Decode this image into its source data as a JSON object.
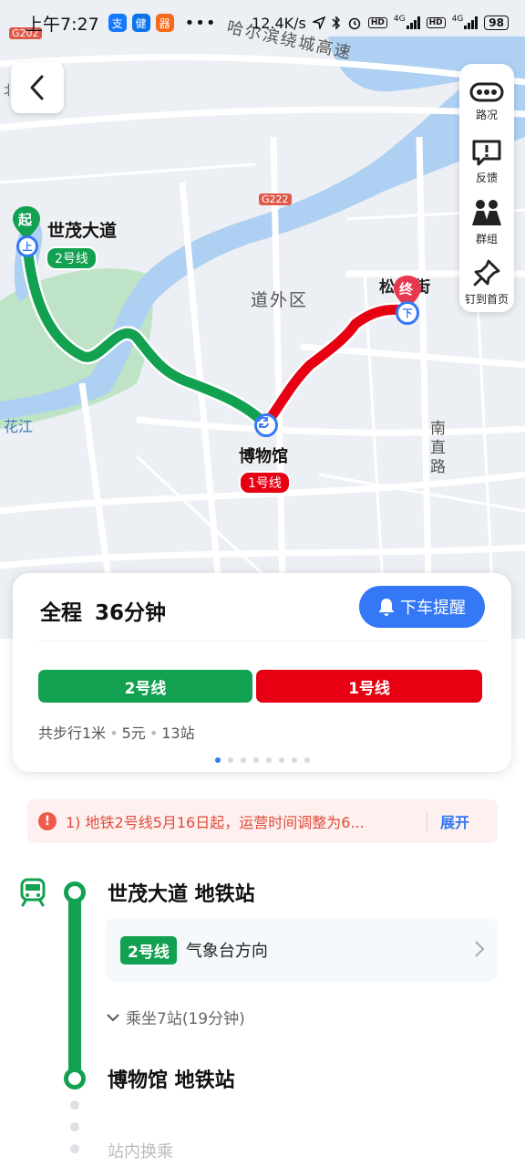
{
  "status_bar": {
    "time": "上午7:27",
    "badges": [
      "支",
      "健",
      "器"
    ],
    "badge_colors": [
      "#1677ff",
      "#0a74e8",
      "#f76b1c"
    ],
    "more": "•••",
    "speed": "12.4K/s",
    "net_1": "4G",
    "net_2": "4G",
    "hd": "HD",
    "battery": "98"
  },
  "map_labels": {
    "road_g202": "G202",
    "road_g222": "G222",
    "highway": "哈尔滨绕城高速",
    "district": "道外区",
    "river": "花江",
    "street_south": "南直路",
    "edge_text": "北",
    "end_area": "松街",
    "start_marker": "起",
    "end_marker": "终",
    "start_station": "世茂大道",
    "start_line": "2号线",
    "transfer_station": "博物馆",
    "transfer_line": "1号线"
  },
  "tools": [
    {
      "label": "路况",
      "icon": "traffic-icon"
    },
    {
      "label": "反馈",
      "icon": "feedback-icon"
    },
    {
      "label": "群组",
      "icon": "group-icon"
    },
    {
      "label": "钉到首页",
      "icon": "pin-icon"
    }
  ],
  "summary": {
    "title_prefix": "全程",
    "duration": "36分钟",
    "remind_label": "下车提醒",
    "segments": [
      {
        "label": "2号线",
        "color": "#12a150",
        "share": 0.49
      },
      {
        "label": "1号线",
        "color": "#e60012",
        "share": 0.51
      }
    ],
    "walk": "共步行1米",
    "price": "5元",
    "stops": "13站",
    "page_count": 8,
    "active_page": 0
  },
  "notice": {
    "icon": "!",
    "text": "1) 地铁2号线5月16日起，运营时间调整为6...",
    "expand": "展开"
  },
  "steps": {
    "start_station": "世茂大道 地铁站",
    "line_tag": "2号线",
    "direction": "气象台方向",
    "ride_info": "乘坐7站(19分钟)",
    "transfer_station": "博物馆 地铁站",
    "next_hint": "站内换乘"
  },
  "colors": {
    "line2": "#12a150",
    "line1": "#e60012",
    "accent": "#3478f6"
  }
}
